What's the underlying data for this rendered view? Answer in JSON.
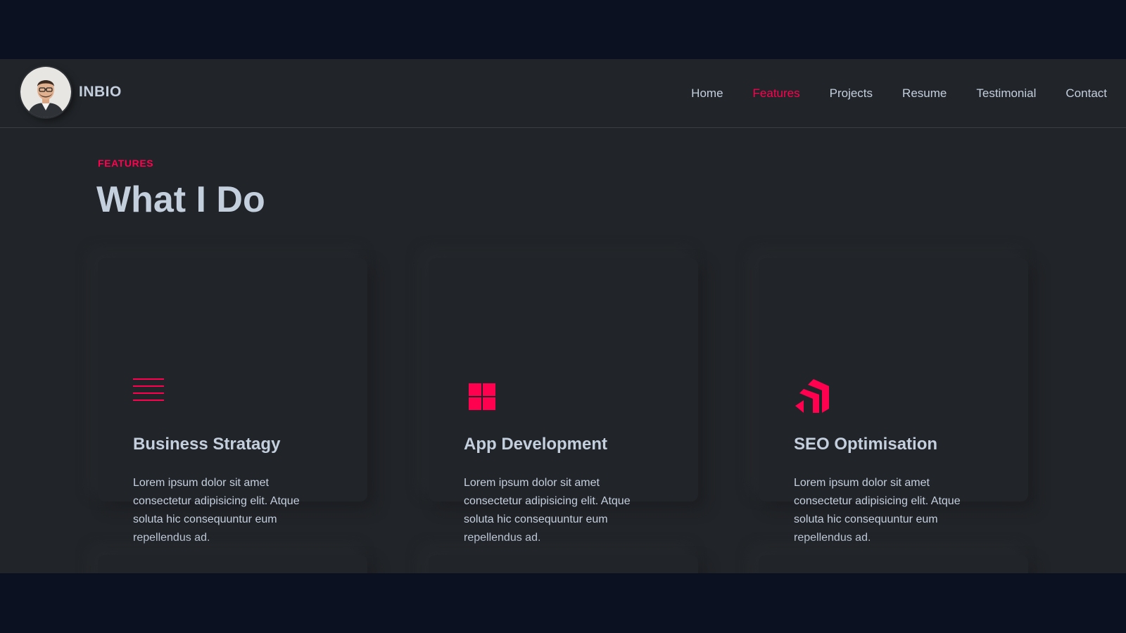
{
  "header": {
    "brand_name": "INBIO",
    "avatar_icon": "person-avatar-icon",
    "nav": [
      {
        "label": "Home",
        "active": false
      },
      {
        "label": "Features",
        "active": true
      },
      {
        "label": "Projects",
        "active": false
      },
      {
        "label": "Resume",
        "active": false
      },
      {
        "label": "Testimonial",
        "active": false
      },
      {
        "label": "Contact",
        "active": false
      }
    ]
  },
  "section": {
    "eyebrow": "FEATURES",
    "title": "What I Do"
  },
  "cards": [
    {
      "icon": "menu-lines-icon",
      "title": "Business Stratagy",
      "text": "Lorem ipsum dolor sit amet consectetur adipisicing elit. Atque soluta hic consequuntur eum repellendus ad."
    },
    {
      "icon": "grid-icon",
      "title": "App Development",
      "text": "Lorem ipsum dolor sit amet consectetur adipisicing elit. Atque soluta hic consequuntur eum repellendus ad."
    },
    {
      "icon": "arrow-logo-icon",
      "title": "SEO Optimisation",
      "text": "Lorem ipsum dolor sit amet consectetur adipisicing elit. Atque soluta hic consequuntur eum repellendus ad."
    }
  ],
  "colors": {
    "accent": "#ff014f",
    "background": "#212428",
    "text": "#c4cfde",
    "outer": "#0b1120"
  }
}
